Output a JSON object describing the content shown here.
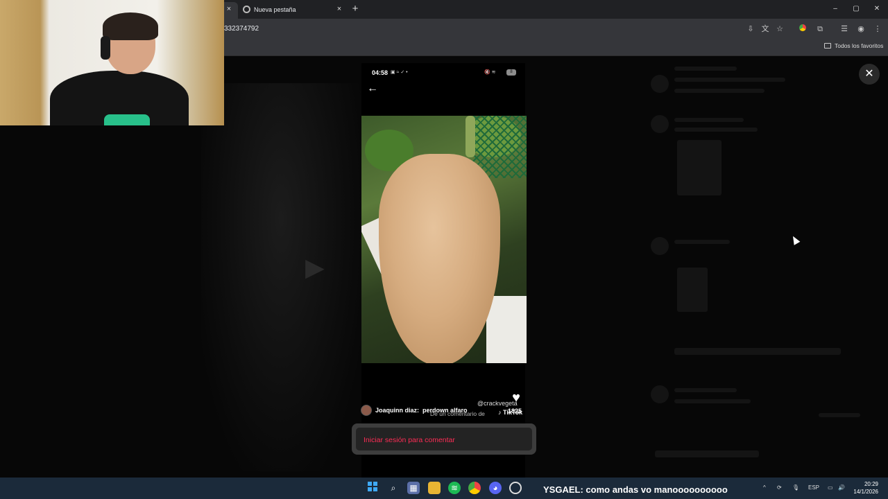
{
  "browser": {
    "tabs": [
      {
        "label": "",
        "close": "×"
      },
      {
        "label": "Nueva pestaña",
        "close": "×"
      }
    ],
    "new_tab": "+",
    "window_controls": {
      "minimize": "–",
      "maximize": "▢",
      "close": "✕"
    },
    "url": "332374792",
    "bookmarks_all": "Todos los favoritos"
  },
  "phone": {
    "time": "04:58",
    "status_icons": "▣ ≈ ✓ •",
    "right_icons": "🔇 ≋",
    "battery": "8",
    "back": "←"
  },
  "post": {
    "creator": "@crackvegeta",
    "heart": "♥",
    "comment": {
      "author": "Joaquinn diaz:",
      "text": "perdown alfaro",
      "overlap": "De un comentario de",
      "tiktok": "♪ TikTok",
      "likes": "1825"
    },
    "login_prompt": "Iniciar sesión para comentar",
    "close_modal": "✕"
  },
  "taskbar": {
    "chat": {
      "user": "YSGAEL",
      "message": ": como andas vo manoooooooooo"
    },
    "lang": "ESP",
    "time": "20:29",
    "date": "14/1/2026"
  }
}
